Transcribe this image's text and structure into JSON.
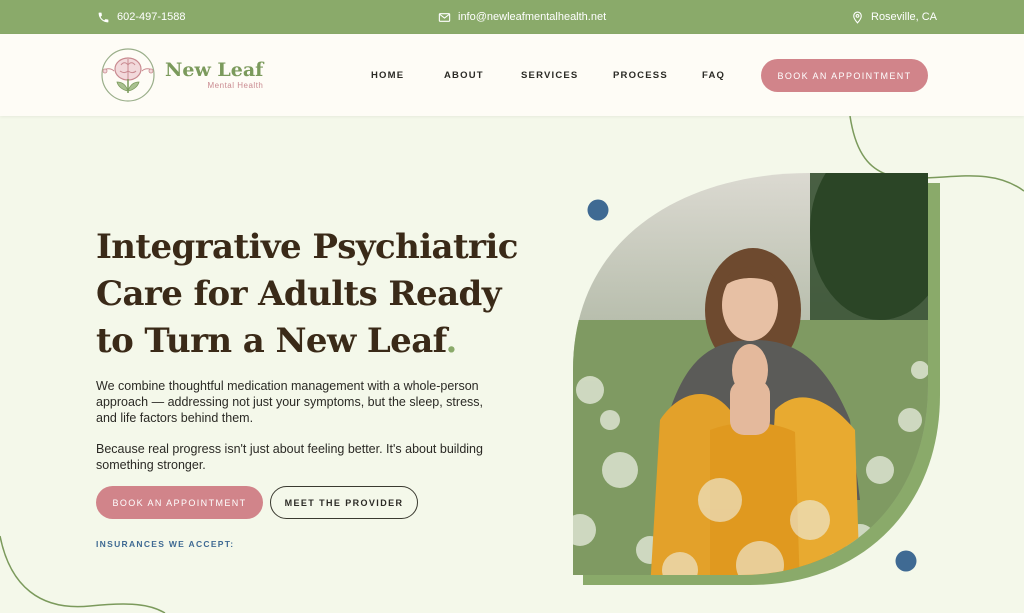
{
  "topbar": {
    "phone": "602-497-1588",
    "email": "info@newleafmentalhealth.net",
    "location": "Roseville, CA"
  },
  "brand": {
    "name": "New Leaf",
    "tagline": "Mental Health"
  },
  "nav": {
    "items": [
      "HOME",
      "ABOUT",
      "SERVICES",
      "PROCESS",
      "FAQ"
    ],
    "cta": "BOOK AN APPOINTMENT"
  },
  "hero": {
    "title_lines": [
      "Integrative Psychiatric",
      "Care for Adults Ready",
      "to Turn a New Leaf"
    ],
    "title_end": ".",
    "paragraph1": "We combine thoughtful medication management with a whole-person approach — addressing not just your symptoms, but the sleep, stress, and life factors behind them.",
    "paragraph2": "Because real progress isn't just about feeling better. It's about building something stronger.",
    "primary_button": "BOOK AN APPOINTMENT",
    "secondary_button": "MEET THE PROVIDER",
    "insurances_label": "INSURANCES WE ACCEPT:"
  },
  "colors": {
    "topbar": "#8aaa6a",
    "accent_pink": "#d1848a",
    "background": "#f4f8ea",
    "title": "#3a2a18",
    "blue_dot": "#3f6a93"
  },
  "icons": [
    "phone-icon",
    "mail-icon",
    "location-pin-icon"
  ]
}
